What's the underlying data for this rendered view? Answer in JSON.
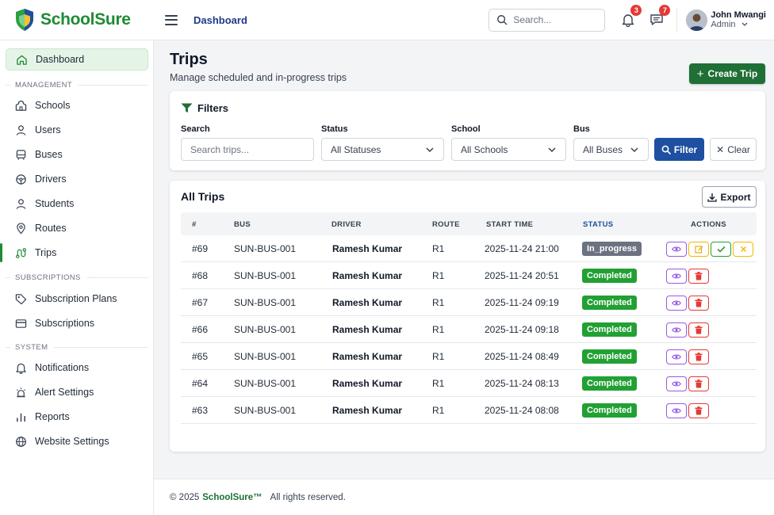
{
  "brand": {
    "name": "SchoolSure"
  },
  "topbar": {
    "title": "Dashboard",
    "search_placeholder": "Search...",
    "notifications_count": "3",
    "messages_count": "7",
    "user_name": "John Mwangi",
    "user_role": "Admin"
  },
  "sidebar": {
    "dashboard": "Dashboard",
    "section_management": "MANAGEMENT",
    "schools": "Schools",
    "users": "Users",
    "buses": "Buses",
    "drivers": "Drivers",
    "students": "Students",
    "routes": "Routes",
    "trips": "Trips",
    "section_subscriptions": "SUBSCRIPTIONS",
    "subscription_plans": "Subscription Plans",
    "subscriptions": "Subscriptions",
    "section_system": "SYSTEM",
    "notifications": "Notifications",
    "alert_settings": "Alert Settings",
    "reports": "Reports",
    "website_settings": "Website Settings"
  },
  "page": {
    "title": "Trips",
    "subtitle": "Manage scheduled and in-progress trips",
    "create_label": "Create Trip"
  },
  "filters": {
    "title": "Filters",
    "search_label": "Search",
    "search_placeholder": "Search trips...",
    "status_label": "Status",
    "status_value": "All Statuses",
    "school_label": "School",
    "school_value": "All Schools",
    "bus_label": "Bus",
    "bus_value": "All Buses",
    "filter_label": "Filter",
    "clear_label": "Clear"
  },
  "table": {
    "title": "All Trips",
    "export_label": "Export",
    "headers": {
      "id": "#",
      "bus": "BUS",
      "driver": "DRIVER",
      "route": "ROUTE",
      "start_time": "START TIME",
      "status": "STATUS",
      "actions": "ACTIONS"
    },
    "rows": [
      {
        "id": "#69",
        "bus": "SUN-BUS-001",
        "driver": "Ramesh Kumar",
        "route": "R1",
        "start_time": "2025-11-24 21:00",
        "status": "In_progress"
      },
      {
        "id": "#68",
        "bus": "SUN-BUS-001",
        "driver": "Ramesh Kumar",
        "route": "R1",
        "start_time": "2025-11-24 20:51",
        "status": "Completed"
      },
      {
        "id": "#67",
        "bus": "SUN-BUS-001",
        "driver": "Ramesh Kumar",
        "route": "R1",
        "start_time": "2025-11-24 09:19",
        "status": "Completed"
      },
      {
        "id": "#66",
        "bus": "SUN-BUS-001",
        "driver": "Ramesh Kumar",
        "route": "R1",
        "start_time": "2025-11-24 09:18",
        "status": "Completed"
      },
      {
        "id": "#65",
        "bus": "SUN-BUS-001",
        "driver": "Ramesh Kumar",
        "route": "R1",
        "start_time": "2025-11-24 08:49",
        "status": "Completed"
      },
      {
        "id": "#64",
        "bus": "SUN-BUS-001",
        "driver": "Ramesh Kumar",
        "route": "R1",
        "start_time": "2025-11-24 08:13",
        "status": "Completed"
      },
      {
        "id": "#63",
        "bus": "SUN-BUS-001",
        "driver": "Ramesh Kumar",
        "route": "R1",
        "start_time": "2025-11-24 08:08",
        "status": "Completed"
      }
    ]
  },
  "footer": {
    "prefix": "© 2025",
    "brand": "SchoolSure™",
    "suffix": "All rights reserved."
  },
  "colors": {
    "brand_green": "#1f8a34",
    "primary_blue": "#1e4fa0",
    "status_completed": "#22a034",
    "status_in_progress": "#6b7280"
  }
}
